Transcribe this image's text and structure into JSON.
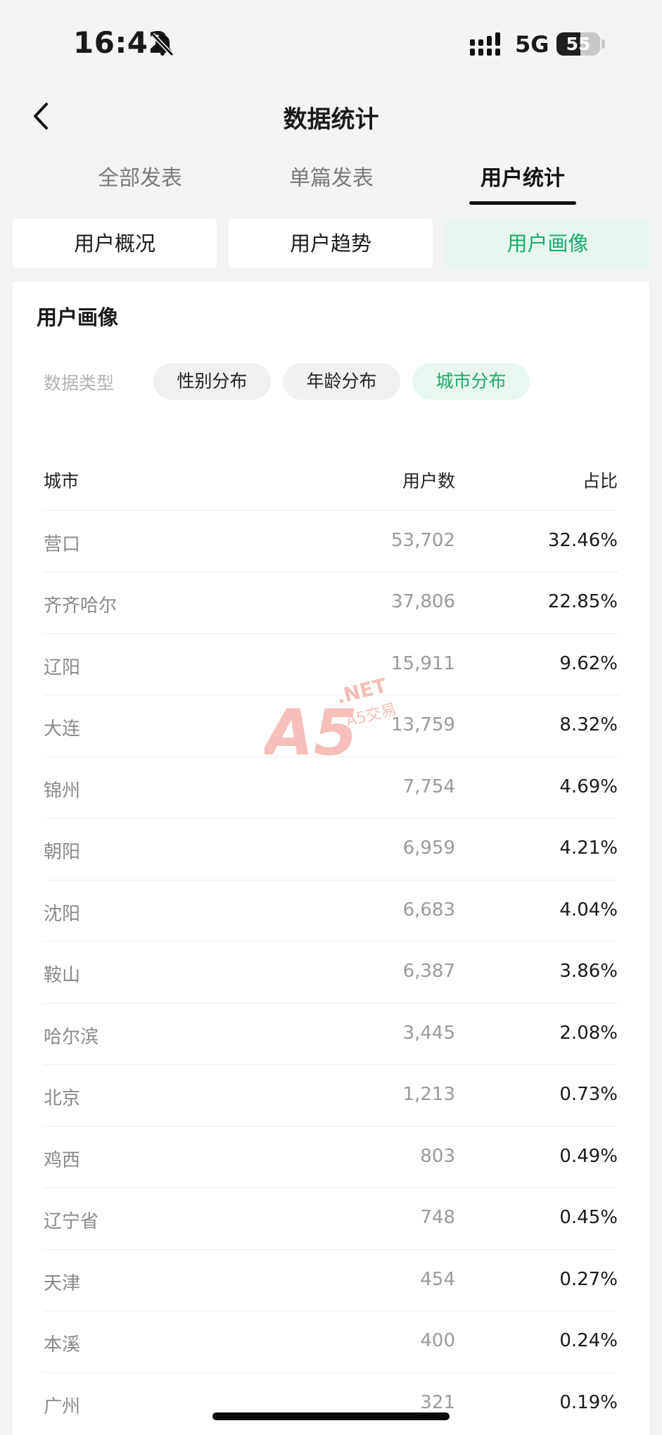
{
  "status": {
    "time": "16:42",
    "network": "5G",
    "battery": "55",
    "battery_level": 0.55
  },
  "header": {
    "title": "数据统计"
  },
  "top_tabs": [
    {
      "label": "全部发表",
      "active": false
    },
    {
      "label": "单篇发表",
      "active": false
    },
    {
      "label": "用户统计",
      "active": true
    }
  ],
  "segments": [
    {
      "label": "用户概况",
      "active": false
    },
    {
      "label": "用户趋势",
      "active": false
    },
    {
      "label": "用户画像",
      "active": true
    }
  ],
  "section": {
    "title": "用户画像",
    "filter_label": "数据类型",
    "chips": [
      {
        "label": "性别分布",
        "active": false
      },
      {
        "label": "年龄分布",
        "active": false
      },
      {
        "label": "城市分布",
        "active": true
      }
    ]
  },
  "table": {
    "headers": {
      "city": "城市",
      "users": "用户数",
      "pct": "占比"
    },
    "rows": [
      {
        "city": "营口",
        "users": "53,702",
        "pct": "32.46%"
      },
      {
        "city": "齐齐哈尔",
        "users": "37,806",
        "pct": "22.85%"
      },
      {
        "city": "辽阳",
        "users": "15,911",
        "pct": "9.62%"
      },
      {
        "city": "大连",
        "users": "13,759",
        "pct": "8.32%"
      },
      {
        "city": "锦州",
        "users": "7,754",
        "pct": "4.69%"
      },
      {
        "city": "朝阳",
        "users": "6,959",
        "pct": "4.21%"
      },
      {
        "city": "沈阳",
        "users": "6,683",
        "pct": "4.04%"
      },
      {
        "city": "鞍山",
        "users": "6,387",
        "pct": "3.86%"
      },
      {
        "city": "哈尔滨",
        "users": "3,445",
        "pct": "2.08%"
      },
      {
        "city": "北京",
        "users": "1,213",
        "pct": "0.73%"
      },
      {
        "city": "鸡西",
        "users": "803",
        "pct": "0.49%"
      },
      {
        "city": "辽宁省",
        "users": "748",
        "pct": "0.45%"
      },
      {
        "city": "天津",
        "users": "454",
        "pct": "0.27%"
      },
      {
        "city": "本溪",
        "users": "400",
        "pct": "0.24%"
      },
      {
        "city": "广州",
        "users": "321",
        "pct": "0.19%"
      }
    ]
  },
  "watermark": {
    "logo": "A5",
    "domain": ".NET",
    "subtitle": "A5交易"
  },
  "colors": {
    "accent": "#1aad6a",
    "accent_bg": "#e7f7ef",
    "watermark": "#e8584a"
  }
}
